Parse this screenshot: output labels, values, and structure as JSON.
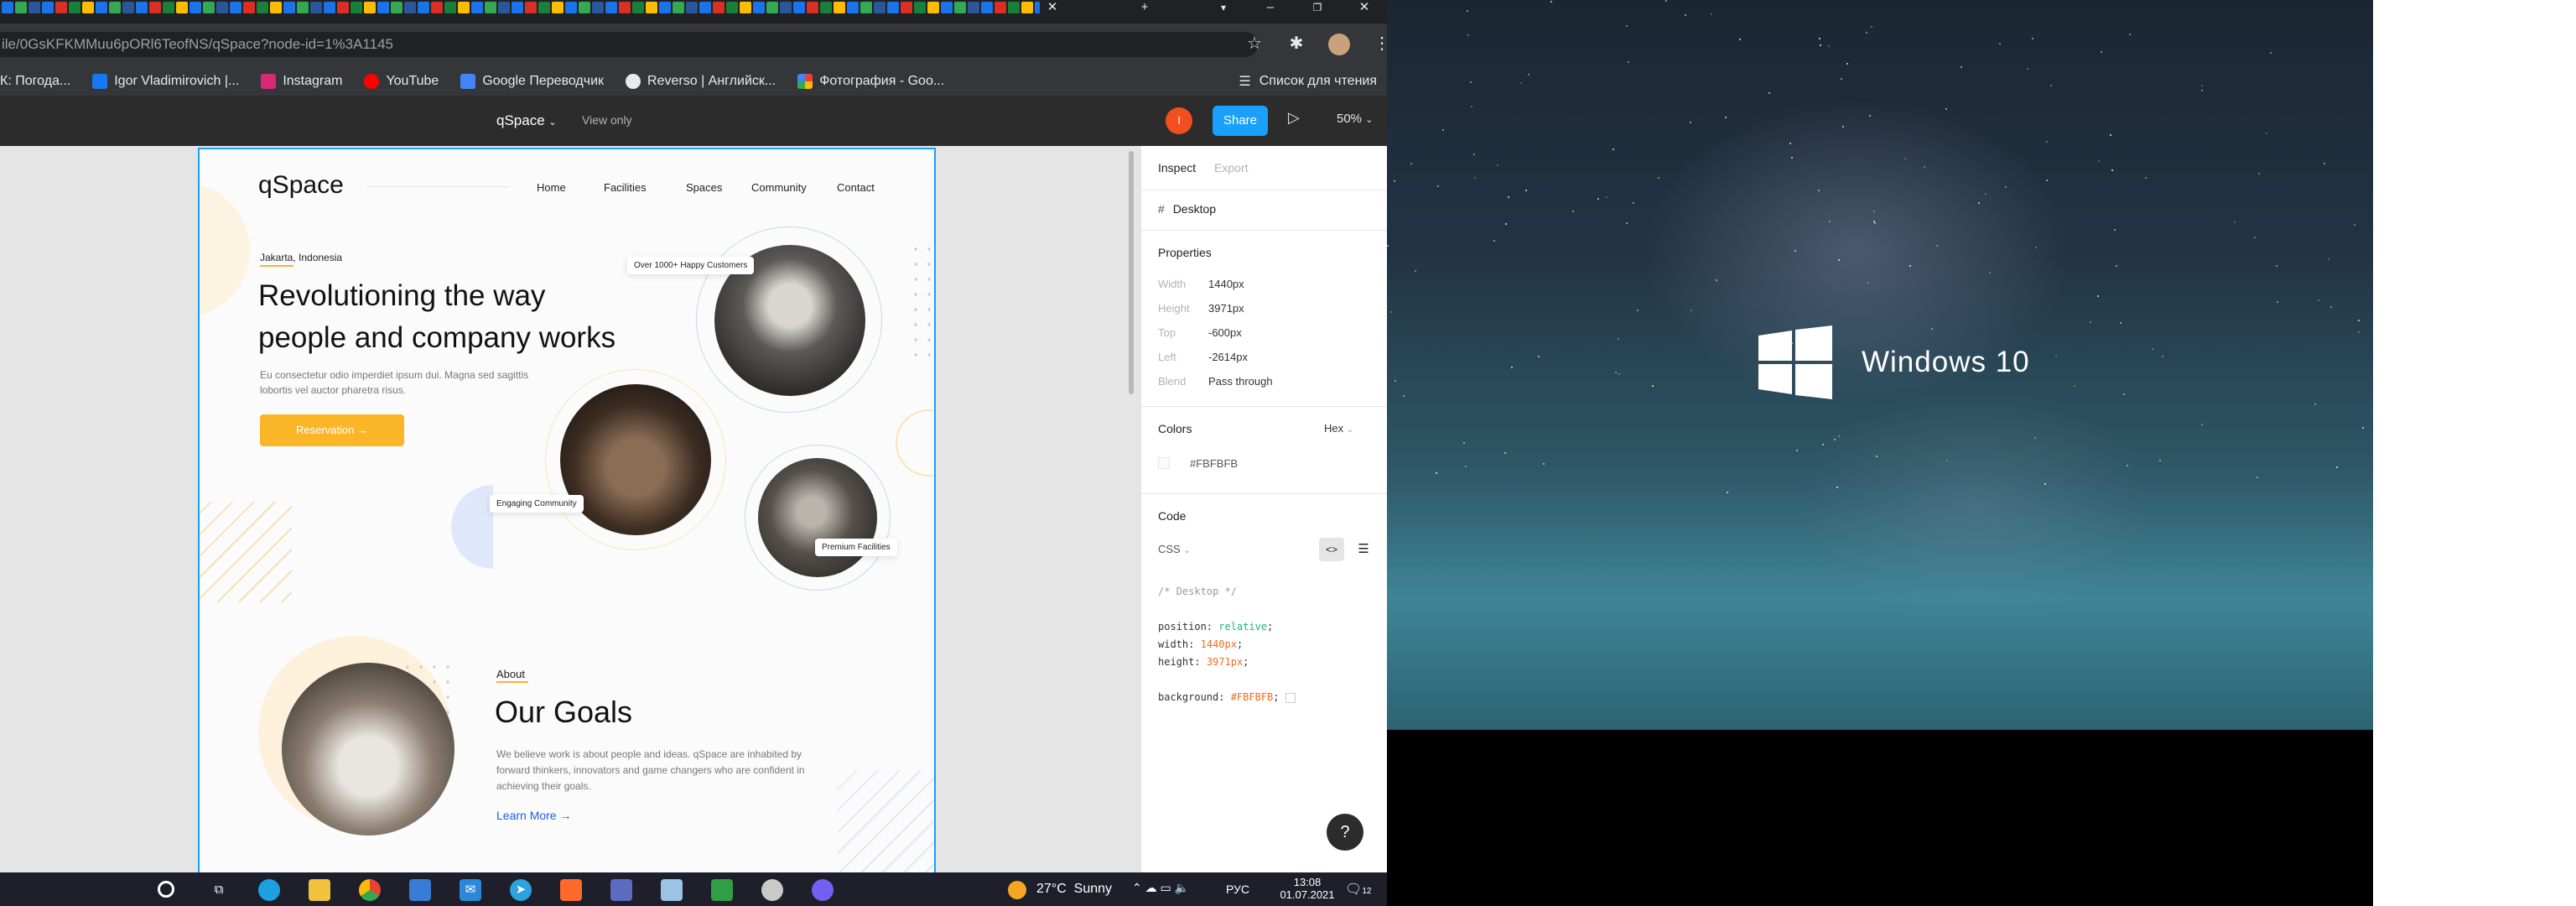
{
  "browser": {
    "url": "ile/0GsKFKMMuu6pORl6TeofNS/qSpace?node-id=1%3A1145",
    "bookmarks": [
      {
        "label": "К: Погода...",
        "color": "#8ab4f8"
      },
      {
        "label": "Igor Vladimirovich |...",
        "color": "#1877f2"
      },
      {
        "label": "Instagram",
        "color": "#d62976"
      },
      {
        "label": "YouTube",
        "color": "#ff0000"
      },
      {
        "label": "Google Переводчик",
        "color": "#4285f4"
      },
      {
        "label": "Reverso | Английск...",
        "color": "#e8eaed"
      },
      {
        "label": "Фотография - Goo...",
        "color": "#ea4335"
      }
    ],
    "reading_list": "Список для чтения"
  },
  "figma": {
    "file_name": "qSpace",
    "view_mode": "View only",
    "user_initial": "I",
    "share_label": "Share",
    "zoom": "50%",
    "inspect_tab": "Inspect",
    "export_tab": "Export",
    "frame_name": "Desktop",
    "properties_title": "Properties",
    "properties": [
      {
        "label": "Width",
        "value": "1440px"
      },
      {
        "label": "Height",
        "value": "3971px"
      },
      {
        "label": "Top",
        "value": "-600px"
      },
      {
        "label": "Left",
        "value": "-2614px"
      },
      {
        "label": "Blend",
        "value": "Pass through"
      }
    ],
    "colors_title": "Colors",
    "color_format": "Hex",
    "color_value": "#FBFBFB",
    "code_title": "Code",
    "code_lang": "CSS",
    "code_comment": "/* Desktop */",
    "code_lines": [
      {
        "prop": "position",
        "value": "relative"
      },
      {
        "prop": "width",
        "value": "1440px"
      },
      {
        "prop": "height",
        "value": "3971px"
      },
      {
        "prop": "background",
        "value": "#FBFBFB"
      }
    ],
    "help": "?"
  },
  "design": {
    "logo": "qSpace",
    "nav": [
      "Home",
      "Facilities",
      "Spaces",
      "Community",
      "Contact"
    ],
    "city": "Jakarta, Indonesia",
    "headline_1": "Revolutioning the way",
    "headline_2": "people and company works",
    "description": "Eu consectetur odio imperdiet ipsum dui. Magna sed sagittis lobortis vel auctor pharetra risus.",
    "cta": "Reservation",
    "tag_customers": "Over 1000+ Happy Customers",
    "tag_community": "Engaging Community",
    "tag_facilities": "Premium Facilities",
    "about_label": "About",
    "about_title": "Our Goals",
    "about_text": "We believe work is about people and ideas. qSpace are inhabited by forward thinkers, innovators and game changers who are confident in achieving their goals.",
    "learn_more": "Learn More"
  },
  "taskbar": {
    "weather_temp": "27°C",
    "weather_text": "Sunny",
    "language": "РУС",
    "time": "13:08",
    "date": "01.07.2021",
    "notifications": "12"
  },
  "desktop": {
    "os_label": "Windows 10"
  }
}
